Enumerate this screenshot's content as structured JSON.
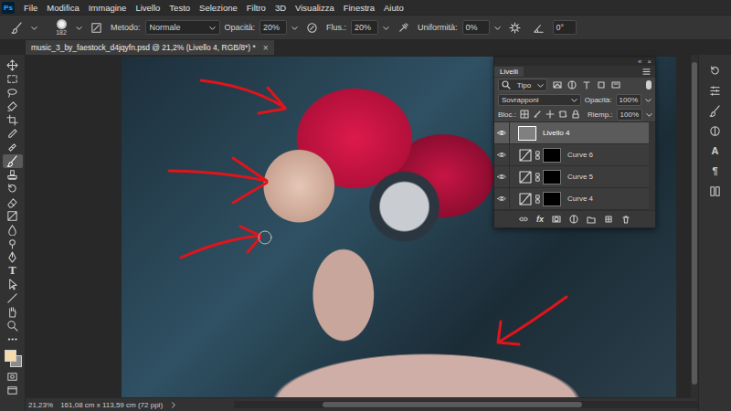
{
  "app": {
    "logo": "Ps"
  },
  "menu": [
    "File",
    "Modifica",
    "Immagine",
    "Livello",
    "Testo",
    "Selezione",
    "Filtro",
    "3D",
    "Visualizza",
    "Finestra",
    "Aiuto"
  ],
  "options_bar": {
    "brush_size": "182",
    "mode_label": "Metodo:",
    "mode": "Normale",
    "opacity_label": "Opacità:",
    "opacity": "20%",
    "flow_label": "Flus.:",
    "flow": "20%",
    "smoothing_label": "Uniformità:",
    "smoothing": "0%",
    "angle": "0°"
  },
  "document_tab": {
    "title": "music_3_by_faestock_d4jqyfn.psd @ 21,2% (Livello 4, RGB/8*) *",
    "close": "×",
    "selected": true
  },
  "toolbar": {
    "tools": [
      {
        "kind": "move",
        "selected": false
      },
      {
        "kind": "marquee",
        "selected": false
      },
      {
        "kind": "lasso",
        "selected": false
      },
      {
        "kind": "quickselect",
        "selected": false
      },
      {
        "kind": "crop",
        "selected": false
      },
      {
        "kind": "eyedropper",
        "selected": false
      },
      {
        "kind": "heal",
        "selected": false
      },
      {
        "kind": "brush",
        "selected": true
      },
      {
        "kind": "stamp",
        "selected": false
      },
      {
        "kind": "history",
        "selected": false
      },
      {
        "kind": "eraser",
        "selected": false
      },
      {
        "kind": "gradient",
        "selected": false
      },
      {
        "kind": "blur",
        "selected": false
      },
      {
        "kind": "dodge",
        "selected": false
      },
      {
        "kind": "pen",
        "selected": false
      },
      {
        "kind": "text",
        "glyph": "T",
        "selected": false
      },
      {
        "kind": "pathselect",
        "selected": false
      },
      {
        "kind": "line",
        "selected": false
      },
      {
        "kind": "hand",
        "selected": false
      },
      {
        "kind": "zoom",
        "selected": false
      },
      {
        "kind": "more",
        "selected": false
      }
    ],
    "foreground_color": "#f4dcae",
    "background_color": "#8c8c8c"
  },
  "right_dock": {
    "icons": [
      {
        "kind": "history"
      },
      {
        "kind": "properties"
      },
      {
        "kind": "brush"
      },
      {
        "kind": "adjust"
      },
      {
        "kind": "char",
        "glyph": "A"
      },
      {
        "kind": "para",
        "glyph": "¶"
      },
      {
        "kind": "libraries"
      }
    ]
  },
  "layers_panel": {
    "collapse": "«",
    "close": "×",
    "tab": "Livelli",
    "filter": "Tipo",
    "blend_mode": "Sovrapponi",
    "opacity_label": "Opacità:",
    "opacity": "100%",
    "lock_label": "Bloc.:",
    "fill_label": "Riemp.:",
    "fill": "100%",
    "layers": [
      {
        "name": "Livello 4",
        "kind": "pixel",
        "visible": true,
        "selected": true
      },
      {
        "name": "Curve 6",
        "kind": "curves",
        "visible": true,
        "selected": false
      },
      {
        "name": "Curve 5",
        "kind": "curves",
        "visible": true,
        "selected": false
      },
      {
        "name": "Curve 4",
        "kind": "curves",
        "visible": true,
        "selected": false
      }
    ],
    "footer_fx": "fx"
  },
  "status_bar": {
    "zoom": "21,23%",
    "size": "161,08 cm x 113,59 cm (72 ppi)",
    "h_scroll_offset": 0.19,
    "h_scroll_level": 0.56,
    "v_scroll_offset": 0.02,
    "v_scroll_level": 0.94
  }
}
